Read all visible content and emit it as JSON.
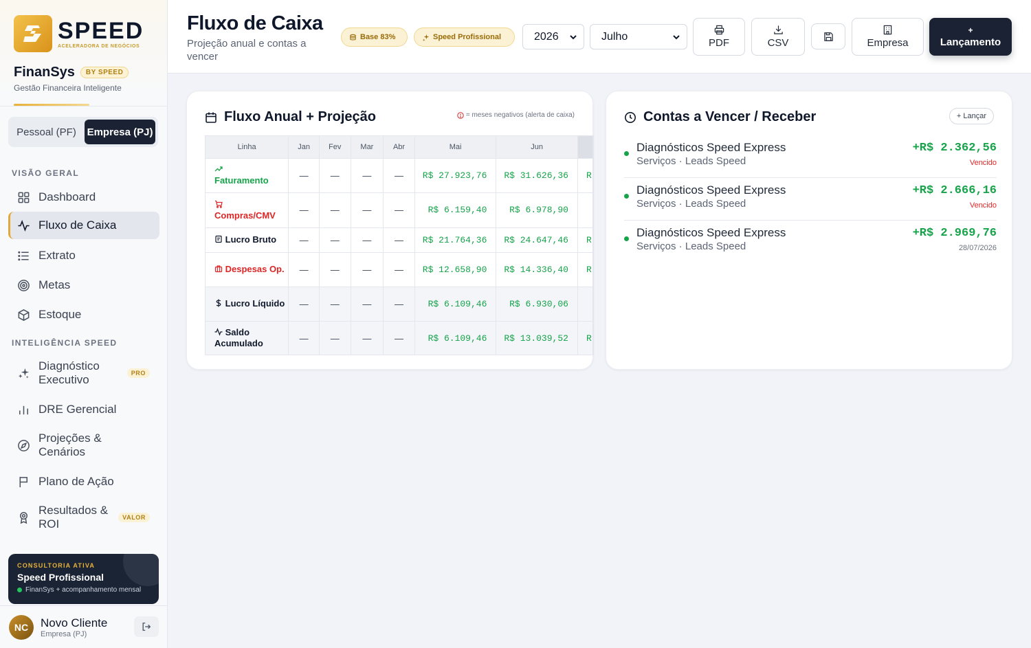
{
  "brand": {
    "logo_word": "SPEED",
    "logo_tag": "ACELERADORA DE NEGÓCIOS",
    "app_name": "FinanSys",
    "by_badge": "BY SPEED",
    "subtitle": "Gestão Financeira Inteligente"
  },
  "mode_toggle": {
    "personal": "Pessoal (PF)",
    "business": "Empresa (PJ)",
    "active": "business"
  },
  "nav": {
    "section_overview": "VISÃO GERAL",
    "section_intel": "INTELIGÊNCIA SPEED",
    "items": [
      {
        "label": "Dashboard",
        "icon": "grid-icon"
      },
      {
        "label": "Fluxo de Caixa",
        "icon": "activity-icon",
        "active": true
      },
      {
        "label": "Extrato",
        "icon": "list-icon"
      },
      {
        "label": "Metas",
        "icon": "target-icon"
      },
      {
        "label": "Estoque",
        "icon": "box-icon"
      },
      {
        "label": "Diagnóstico Executivo",
        "icon": "sparkles-icon",
        "pill": "PRO"
      },
      {
        "label": "DRE Gerencial",
        "icon": "bar-chart-icon"
      },
      {
        "label": "Projeções & Cenários",
        "icon": "compass-icon"
      },
      {
        "label": "Plano de Ação",
        "icon": "flag-icon"
      },
      {
        "label": "Resultados & ROI",
        "icon": "award-icon",
        "pill": "VALOR"
      }
    ]
  },
  "consulting": {
    "kicker": "CONSULTORIA ATIVA",
    "title": "Speed Profissional",
    "sub": "FinanSys + acompanhamento mensal"
  },
  "user": {
    "initials": "NC",
    "name": "Novo Cliente",
    "sub": "Empresa (PJ)"
  },
  "header": {
    "title": "Fluxo de Caixa",
    "subtitle": "Projeção anual e contas a vencer",
    "badge_base": "Base 83%",
    "badge_plan": "Speed Profissional",
    "year": "2026",
    "month": "Julho",
    "btn_pdf": "PDF",
    "btn_csv": "CSV",
    "btn_company": "Empresa",
    "btn_new_plus": "+",
    "btn_new": "Lançamento"
  },
  "annual": {
    "title": "Fluxo Anual + Projeção",
    "alert_note": "= meses negativos (alerta de caixa)",
    "columns": [
      "Linha",
      "Jan",
      "Fev",
      "Mar",
      "Abr",
      "Mai",
      "Jun"
    ],
    "rows": [
      {
        "label": "Faturamento",
        "icon": "trending-up-icon",
        "color": "green",
        "cells": [
          "—",
          "—",
          "—",
          "—",
          "R$ 27.923,76",
          "R$ 31.626,36"
        ],
        "overflow": "R"
      },
      {
        "label": "Compras/CMV",
        "icon": "cart-icon",
        "color": "red",
        "cells": [
          "—",
          "—",
          "—",
          "—",
          "R$ 6.159,40",
          "R$ 6.978,90"
        ],
        "overflow": ""
      },
      {
        "label": "Lucro Bruto",
        "icon": "receipt-icon",
        "color": "dark",
        "cells": [
          "—",
          "—",
          "—",
          "—",
          "R$ 21.764,36",
          "R$ 24.647,46"
        ],
        "overflow": "R"
      },
      {
        "label": "Despesas Op.",
        "icon": "briefcase-icon",
        "color": "red",
        "cells": [
          "—",
          "—",
          "—",
          "—",
          "R$ 12.658,90",
          "R$ 14.336,40"
        ],
        "overflow": "R"
      },
      {
        "label": "Lucro Líquido",
        "icon": "dollar-icon",
        "color": "dark",
        "shade": true,
        "cells": [
          "—",
          "—",
          "—",
          "—",
          "R$ 6.109,46",
          "R$ 6.930,06"
        ],
        "overflow": ""
      },
      {
        "label": "Saldo Acumulado",
        "icon": "pulse-icon",
        "color": "dark",
        "shade": true,
        "cells": [
          "—",
          "—",
          "—",
          "—",
          "R$ 6.109,46",
          "R$ 13.039,52"
        ],
        "overflow": "R"
      }
    ]
  },
  "bills": {
    "title": "Contas a Vencer / Receber",
    "add_button": "+ Lançar",
    "items": [
      {
        "name": "Diagnósticos Speed Express",
        "sub": "Serviços · Leads Speed",
        "value": "+R$ 2.362,56",
        "status": "Vencido",
        "late": true
      },
      {
        "name": "Diagnósticos Speed Express",
        "sub": "Serviços · Leads Speed",
        "value": "+R$ 2.666,16",
        "status": "Vencido",
        "late": true
      },
      {
        "name": "Diagnósticos Speed Express",
        "sub": "Serviços · Leads Speed",
        "value": "+R$ 2.969,76",
        "status": "28/07/2026",
        "late": false
      }
    ]
  },
  "colors": {
    "accent": "#e2a93a",
    "dark": "#1a2233",
    "positive": "#16a34a",
    "negative": "#dc2626"
  }
}
